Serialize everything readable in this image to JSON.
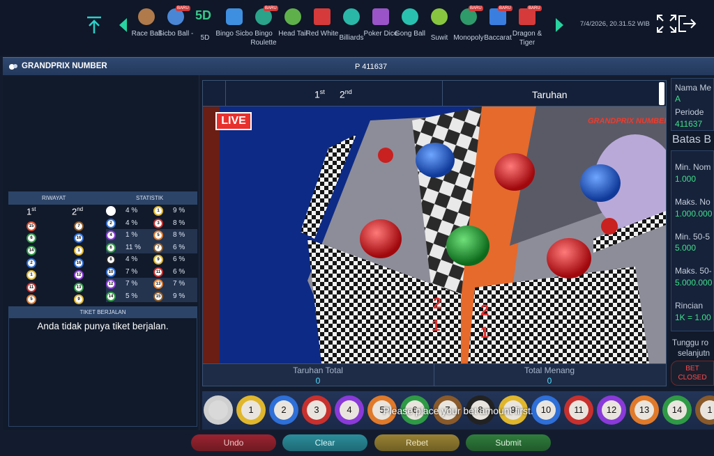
{
  "topbar": {
    "games": [
      {
        "label": "Race Ball",
        "icon": "race-ball-icon",
        "badge": ""
      },
      {
        "label": "Sicbo Ball -",
        "icon": "sicbo-ball-icon",
        "badge": "BARU"
      },
      {
        "label": "5D",
        "icon": "5d-icon",
        "badge": ""
      },
      {
        "label": "Bingo Sicbo",
        "icon": "bingo-sicbo-icon",
        "badge": ""
      },
      {
        "label": "Bingo Roulette",
        "icon": "bingo-roulette-icon",
        "badge": "BARU"
      },
      {
        "label": "Head Tail",
        "icon": "head-tail-icon",
        "badge": ""
      },
      {
        "label": "Red White",
        "icon": "red-white-icon",
        "badge": ""
      },
      {
        "label": "Billiards",
        "icon": "billiards-icon",
        "badge": ""
      },
      {
        "label": "Poker Dice",
        "icon": "poker-dice-icon",
        "badge": ""
      },
      {
        "label": "Gong Ball",
        "icon": "gong-ball-icon",
        "badge": ""
      },
      {
        "label": "Suwit",
        "icon": "suwit-icon",
        "badge": ""
      },
      {
        "label": "Monopoly",
        "icon": "monopoly-icon",
        "badge": "BARU"
      },
      {
        "label": "Baccarat",
        "icon": "baccarat-icon",
        "badge": "BARU"
      },
      {
        "label": "Dragon & Tiger",
        "icon": "dragon-tiger-icon",
        "badge": "BARU"
      }
    ],
    "fivedLabel": "5D",
    "datetime": "7/4/2026, 20.31.52 WIB"
  },
  "header": {
    "title": "GRANDPRIX NUMBER",
    "period": "P 411637"
  },
  "history": {
    "riwayat_label": "RIWAYAT",
    "statistik_label": "STATISTIK",
    "first_label": "1",
    "first_sup": "st",
    "second_label": "2",
    "second_sup": "nd",
    "first": [
      "15",
      "6",
      "14",
      "2",
      "1",
      "11",
      "5"
    ],
    "second": [
      "7",
      "16",
      "1",
      "16",
      "12",
      "13",
      "9"
    ],
    "stats": [
      {
        "a_ball": "",
        "a_pct": "4 %",
        "b_ball": "1",
        "b_pct": "9 %"
      },
      {
        "a_ball": "2",
        "a_pct": "4 %",
        "b_ball": "3",
        "b_pct": "8 %"
      },
      {
        "a_ball": "4",
        "a_pct": "1 %",
        "b_ball": "5",
        "b_pct": "8 %"
      },
      {
        "a_ball": "6",
        "a_pct": "11 %",
        "b_ball": "7",
        "b_pct": "6 %"
      },
      {
        "a_ball": "8",
        "a_pct": "4 %",
        "b_ball": "9",
        "b_pct": "6 %"
      },
      {
        "a_ball": "10",
        "a_pct": "7 %",
        "b_ball": "11",
        "b_pct": "6 %"
      },
      {
        "a_ball": "12",
        "a_pct": "7 %",
        "b_ball": "13",
        "b_pct": "7 %"
      },
      {
        "a_ball": "14",
        "a_pct": "5 %",
        "b_ball": "15",
        "b_pct": "9 %"
      }
    ]
  },
  "tiket": {
    "title": "TIKET BERJALAN",
    "message": "Anda tidak punya tiket berjalan."
  },
  "video": {
    "first_label": "1",
    "first_sup": "st",
    "second_label": "2",
    "second_sup": "nd",
    "taruhan_label": "Taruhan",
    "live_label": "LIVE",
    "logo_text": "GRANDPRIX NUMBER",
    "board_numbers": [
      "2",
      "1",
      "2",
      "1"
    ],
    "taruhan_total_label": "Taruhan Total",
    "taruhan_total_value": "0",
    "total_menang_label": "Total Menang",
    "total_menang_value": "0"
  },
  "rightPanel": {
    "nama_label": "Nama Me",
    "nama_value": "A",
    "periode_label": "Periode",
    "periode_value": "411637",
    "batas_label": "Batas B",
    "min_nom_label": "Min. Nom",
    "min_nom_value": "1.000",
    "maks_nom_label": "Maks. No",
    "maks_nom_value": "1.000.000",
    "min_50_label": "Min. 50-5",
    "min_50_value": "5.000",
    "maks_50_label": "Maks. 50-",
    "maks_50_value": "5.000.000",
    "rincian_label": "Rincian",
    "rincian_value": "1K = 1.00",
    "wait_line1": "Tunggu ro",
    "wait_line2": "selanjutn",
    "bet_closed_line1": "BET",
    "bet_closed_line2": "CLOSED"
  },
  "betStrip": {
    "chips": [
      "",
      "1",
      "2",
      "3",
      "4",
      "5",
      "6",
      "7",
      "8",
      "9",
      "10",
      "11",
      "12",
      "13",
      "14",
      "1"
    ],
    "message": "Please place your bet amount first."
  },
  "actions": {
    "undo": "Undo",
    "clear": "Clear",
    "rebet": "Rebet",
    "submit": "Submit"
  },
  "colors": {
    "accent": "#27d3a0",
    "live": "#e8302d",
    "value_green": "#3fe08c",
    "value_cyan": "#55ddff",
    "bet_closed": "#ff4b4b"
  }
}
